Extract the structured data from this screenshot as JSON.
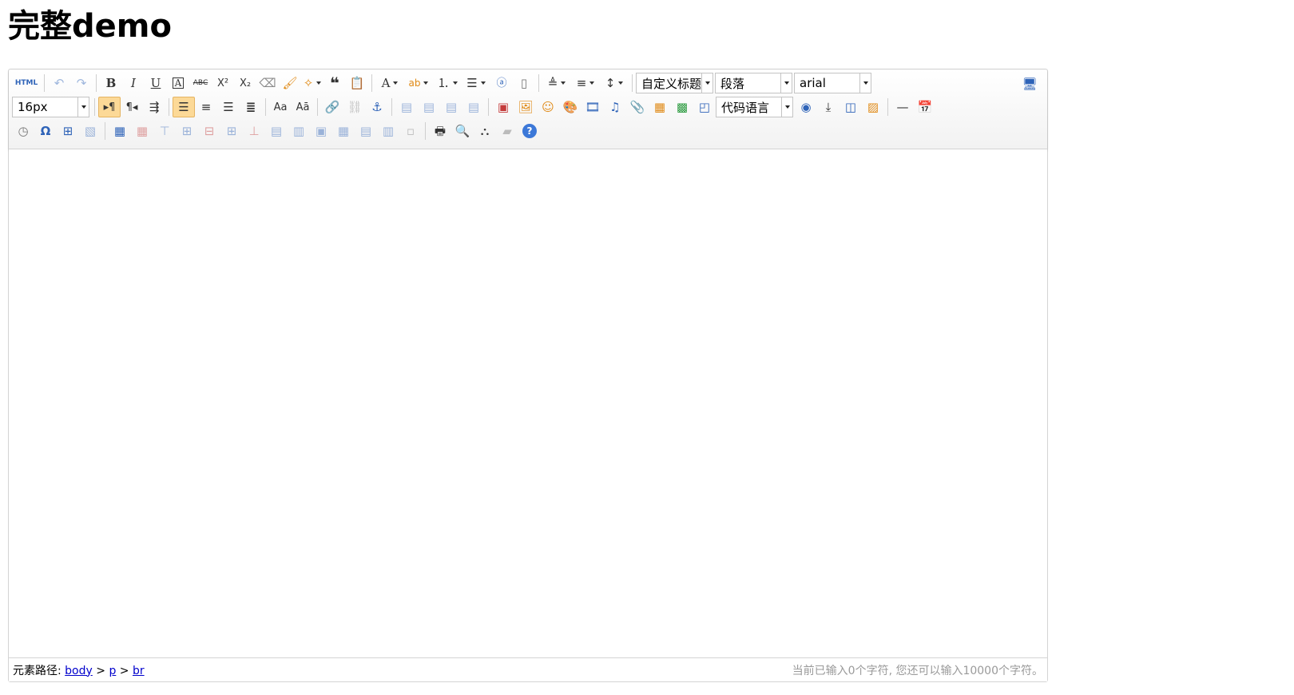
{
  "page": {
    "title": "完整demo"
  },
  "toolbar": {
    "source_label": "HTML",
    "font_size": "16px",
    "custom_style": "自定义标题",
    "paragraph": "段落",
    "font_family": "arial",
    "code_language": "代码语言",
    "icons": {
      "bold": "B",
      "italic": "I",
      "underline": "U",
      "fontborder": "A",
      "strikethrough": "ABC",
      "superscript": "X²",
      "subscript": "X₂",
      "blockquote": "❝",
      "forecolor": "A",
      "special_char": "Ω",
      "help": "?"
    }
  },
  "status": {
    "path_label": "元素路径:",
    "path": [
      "body",
      "p",
      "br"
    ],
    "word_count": "当前已输入0个字符, 您还可以输入10000个字符。"
  },
  "colors": {
    "active_button": "#fcd997",
    "link": "#0000cc",
    "help_blue": "#3c78d8"
  }
}
